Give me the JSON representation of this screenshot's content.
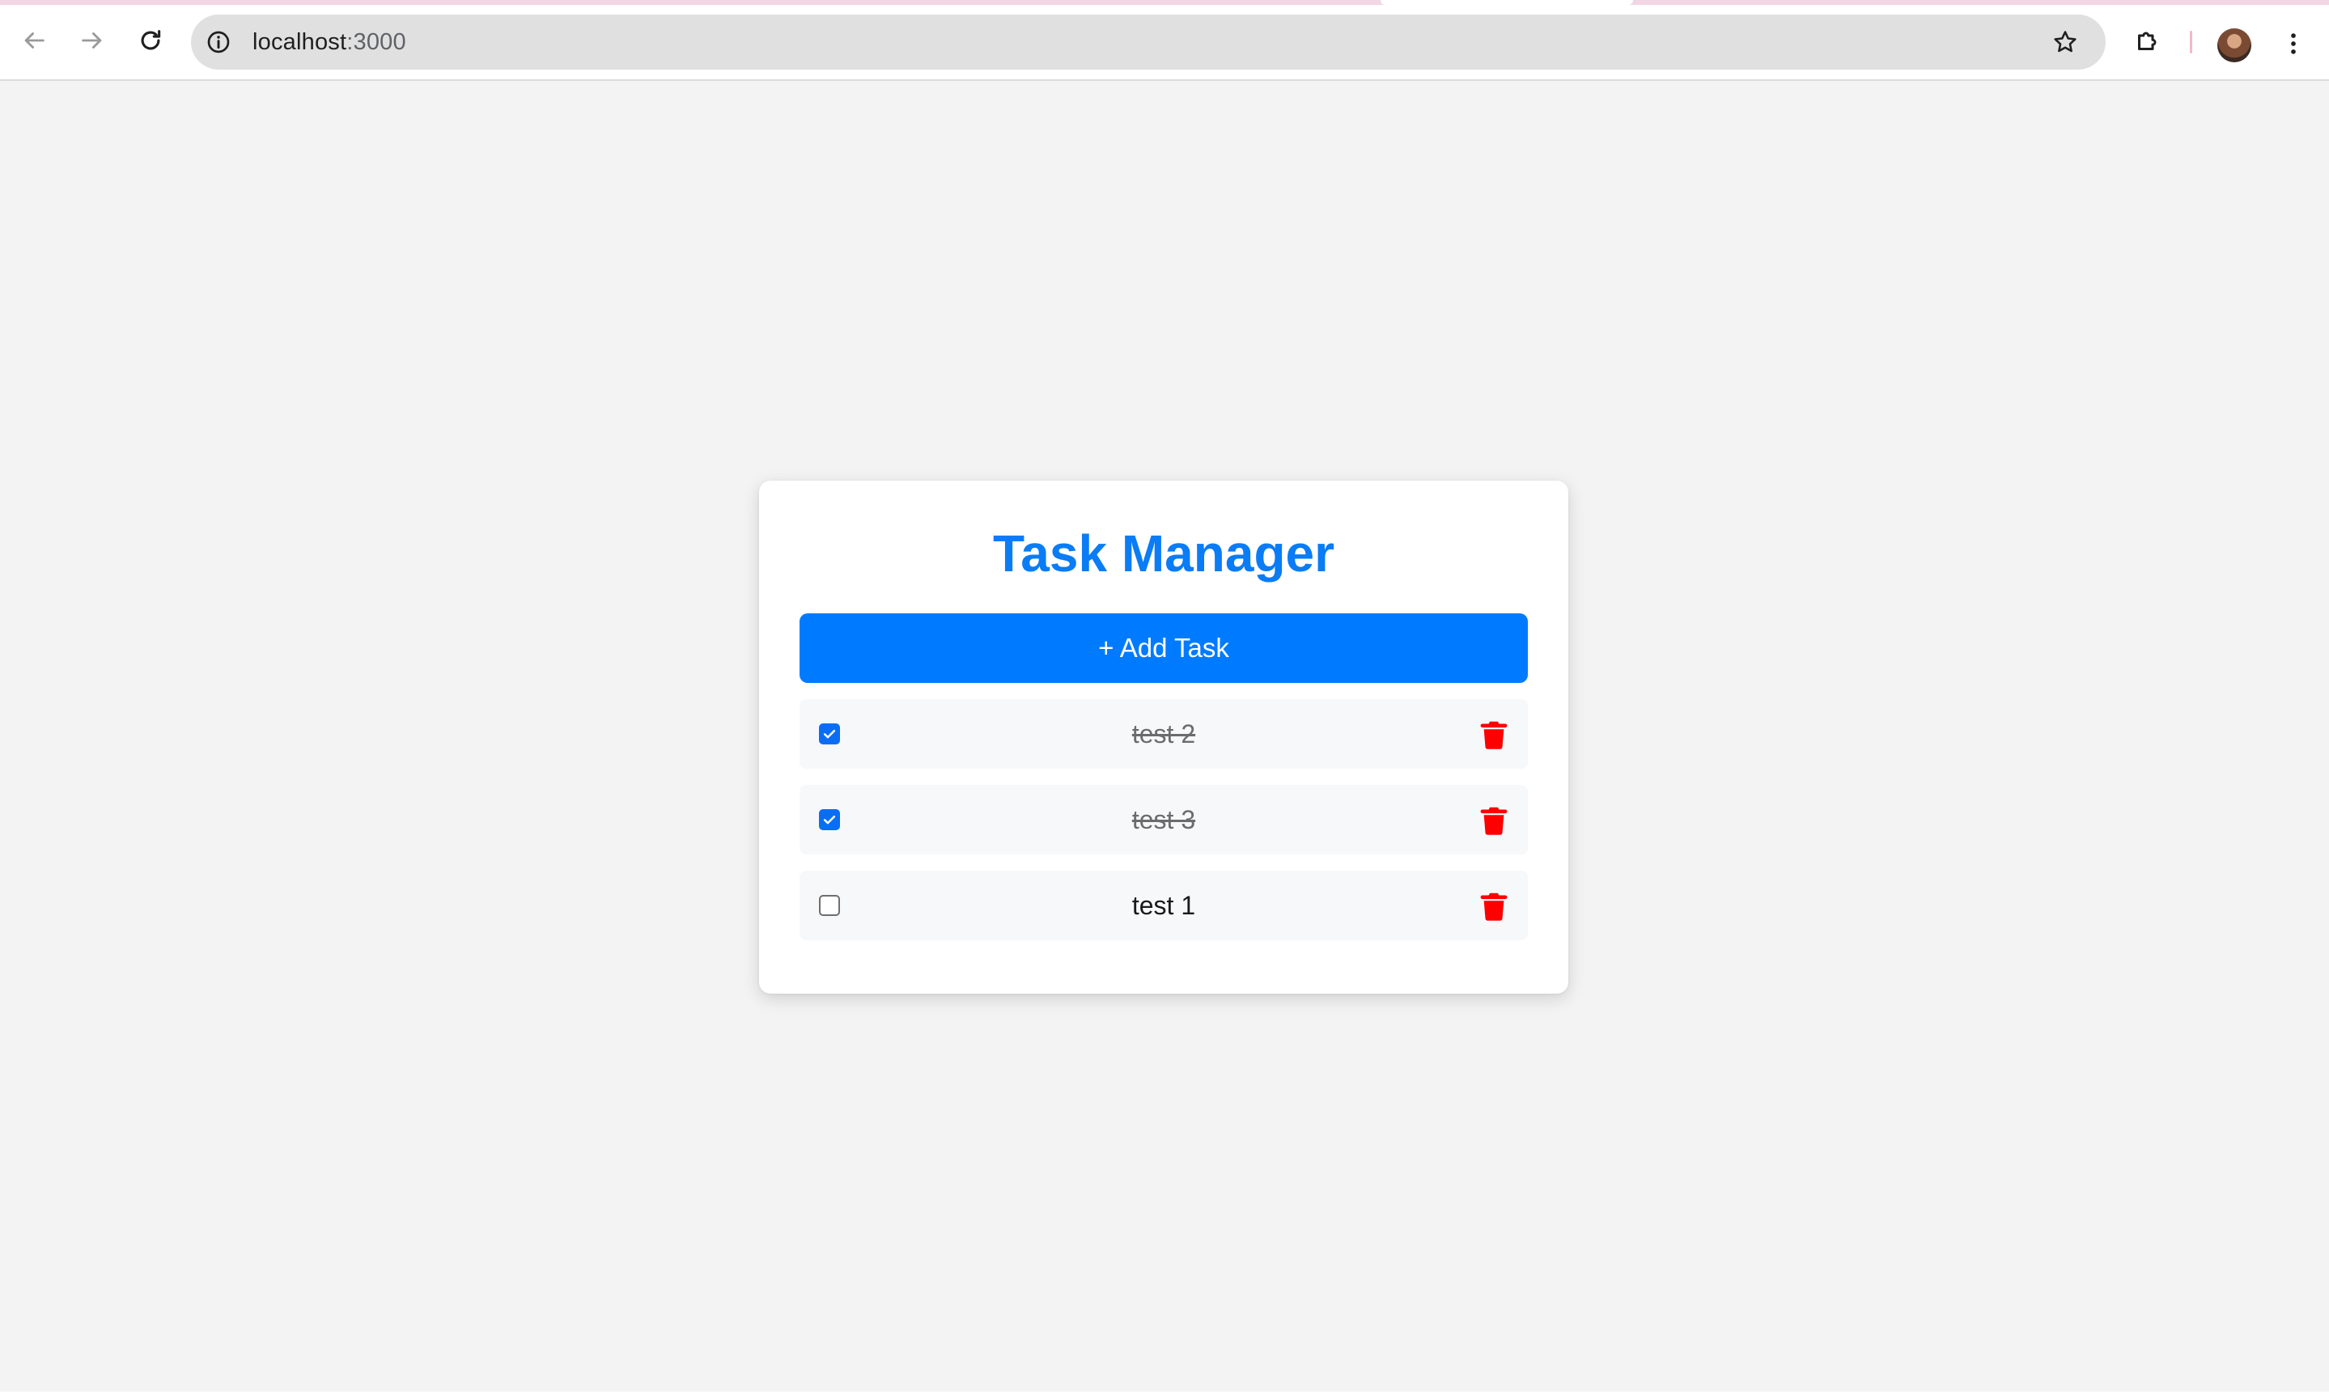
{
  "browser": {
    "url_host": "localhost",
    "url_port": ":3000",
    "icons": {
      "back": "arrow-left-icon",
      "forward": "arrow-right-icon",
      "reload": "reload-icon",
      "site_info": "info-icon",
      "bookmark": "star-icon",
      "extensions": "puzzle-icon",
      "profile": "avatar",
      "menu": "kebab-menu-icon"
    }
  },
  "app": {
    "title": "Task Manager",
    "add_button_label": "+ Add Task",
    "accent_color": "#007bff",
    "delete_color": "#ff0000",
    "tasks": [
      {
        "label": "test 2",
        "completed": true
      },
      {
        "label": "test 3",
        "completed": true
      },
      {
        "label": "test 1",
        "completed": false
      }
    ]
  }
}
